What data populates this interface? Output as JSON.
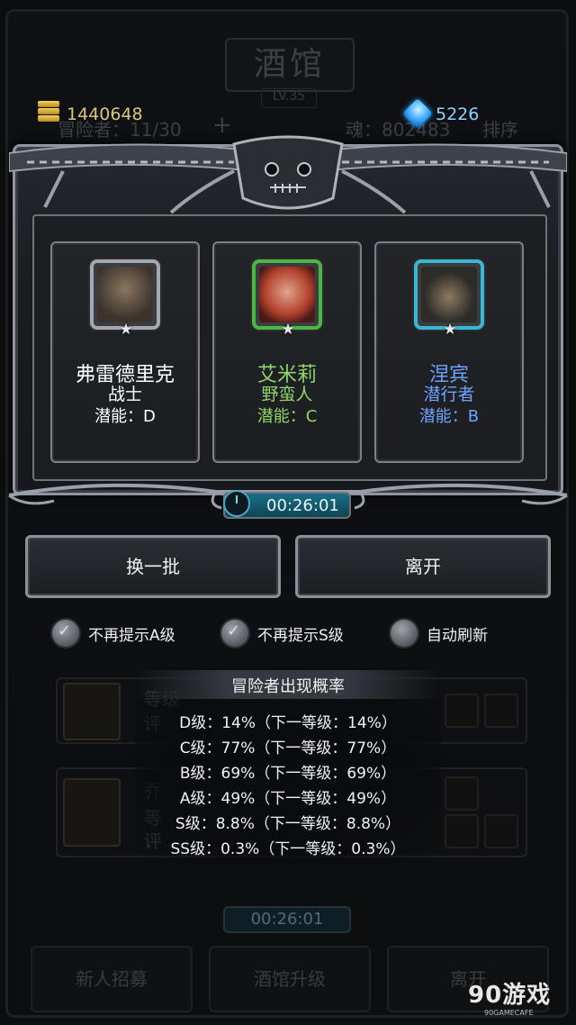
{
  "background": {
    "title": "酒馆",
    "level": "LV.35",
    "adventurer_count": "冒险者：11/30",
    "plus": "+",
    "soul": "魂：802483",
    "sort": "排序",
    "card1_text_a": "等级",
    "card1_text_b": "评",
    "card2_name": "乔",
    "card2_text_a": "等",
    "card2_text_b": "评",
    "timer": "00:26:01",
    "buttons": [
      "新人招募",
      "酒馆升级",
      "离开"
    ]
  },
  "currency": {
    "gold": "1440648",
    "gems": "5226"
  },
  "heroes": [
    {
      "name": "弗雷德里克",
      "class": "战士",
      "potential": "潜能：D",
      "color": "#ffffff",
      "frame": "#a4a9b0",
      "face": "#6b5a4c"
    },
    {
      "name": "艾米莉",
      "class": "野蛮人",
      "potential": "潜能：C",
      "color": "#8fd66a",
      "frame": "#4cb842",
      "face": "#b8503a"
    },
    {
      "name": "涅宾",
      "class": "潜行者",
      "potential": "潜能：B",
      "color": "#6fa2ff",
      "frame": "#3ab7d3",
      "face": "#4c4a44"
    }
  ],
  "star": "★",
  "timer": "00:26:01",
  "buttons": {
    "refresh": "换一批",
    "leave": "离开"
  },
  "options": [
    {
      "label": "不再提示A级",
      "checked": true
    },
    {
      "label": "不再提示S级",
      "checked": true
    },
    {
      "label": "自动刷新",
      "checked": false
    }
  ],
  "probability": {
    "title": "冒险者出现概率",
    "lines": [
      "D级：14%（下一等级：14%）",
      "C级：77%（下一等级：77%）",
      "B级：69%（下一等级：69%）",
      "A级：49%（下一等级：49%）",
      "S级：8.8%（下一等级：8.8%）",
      "SS级：0.3%（下一等级：0.3%）"
    ]
  },
  "watermark": {
    "text": "90游戏",
    "sub": "90GAMECAFE"
  }
}
